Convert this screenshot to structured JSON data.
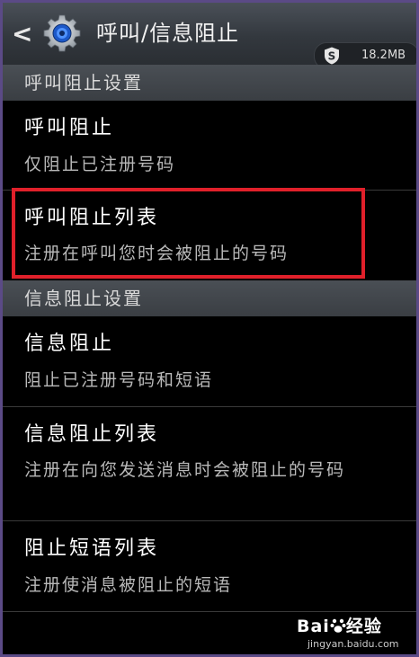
{
  "header": {
    "back_glyph": "<",
    "app_icon": "gear-icon",
    "title": "呼叫/信息阻止",
    "memory_icon": "shield-s-icon",
    "memory_badge_letter": "S",
    "memory": "18.2MB"
  },
  "sections": [
    {
      "title": "呼叫阻止设置",
      "items": [
        {
          "title": "呼叫阻止",
          "subtitle": "仅阻止已注册号码"
        },
        {
          "title": "呼叫阻止列表",
          "subtitle": "注册在呼叫您时会被阻止的号码"
        }
      ]
    },
    {
      "title": "信息阻止设置",
      "items": [
        {
          "title": "信息阻止",
          "subtitle": "阻止已注册号码和短语"
        },
        {
          "title": "信息阻止列表",
          "subtitle": "注册在向您发送消息时会被阻止的号码"
        },
        {
          "title": "阻止短语列表",
          "subtitle": "注册使消息被阻止的短语"
        }
      ]
    }
  ],
  "annotation": {
    "highlight_color": "#e0202a"
  },
  "watermark": {
    "brand": "Bai",
    "brand_suffix": "经验",
    "url": "jingyan.baidu.com"
  },
  "colors": {
    "header": "#3a3f45",
    "section": "#43484e",
    "background": "#000000"
  }
}
